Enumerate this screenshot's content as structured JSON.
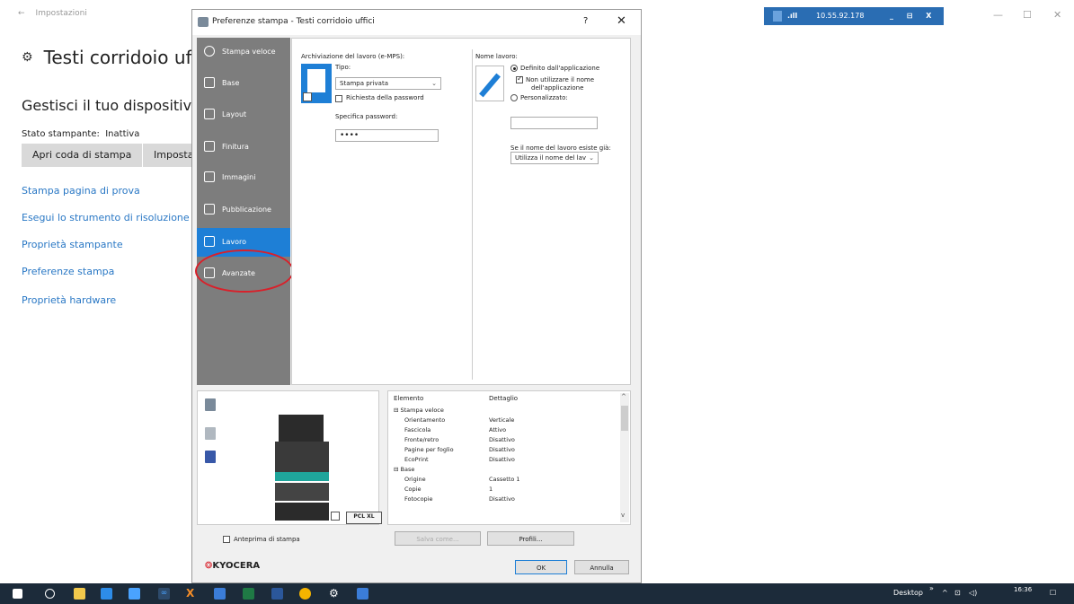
{
  "background_window": {
    "back_label": "Impostazioni",
    "title": "Testi corridoio uff",
    "manage_heading": "Gestisci il tuo dispositivo",
    "status_label": "Stato stampante:",
    "status_value": "Inattiva",
    "buttons": [
      "Apri coda di stampa",
      "Imposta c"
    ],
    "links": [
      "Stampa pagina di prova",
      "Esegui lo strumento di risoluzione dei",
      "Proprietà stampante",
      "Preferenze stampa",
      "Proprietà hardware"
    ]
  },
  "remote_bar": {
    "ip": "10.55.92.178",
    "controls": "_ ⊟ X"
  },
  "dialog": {
    "title": "Preferenze stampa - Testi corridoio uffici",
    "help": "?",
    "close": "✕",
    "sidebar": [
      {
        "label": "Stampa veloce",
        "active": false
      },
      {
        "label": "Base",
        "active": false
      },
      {
        "label": "Layout",
        "active": false
      },
      {
        "label": "Finitura",
        "active": false
      },
      {
        "label": "Immagini",
        "active": false
      },
      {
        "label": "Pubblicazione",
        "active": false
      },
      {
        "label": "Lavoro",
        "active": true
      },
      {
        "label": "Avanzate",
        "active": false
      }
    ],
    "job_storage": {
      "heading": "Archiviazione del lavoro (e-MPS):",
      "type_label": "Tipo:",
      "type_value": "Stampa privata",
      "require_password_label": "Richiesta della password",
      "require_password_checked": false,
      "specify_password_label": "Specifica password:",
      "password_value": "••••"
    },
    "job_name": {
      "heading": "Nome lavoro:",
      "option_app": "Definito dall'applicazione",
      "option_app_selected": true,
      "dont_use_app_name_line1": "Non utilizzare il nome",
      "dont_use_app_name_line2": "dell'applicazione",
      "dont_use_app_name_checked": true,
      "option_custom": "Personalizzato:",
      "custom_value": "",
      "if_exists_label": "Se il nome del lavoro esiste già:",
      "if_exists_value": "Utilizza il nome del lav"
    },
    "preview": {
      "pcl_label": "PCL XL",
      "print_preview_label": "Anteprima di stampa",
      "print_preview_checked": false
    },
    "settings_grid": {
      "headers": [
        "Elemento",
        "Dettaglio"
      ],
      "rows": [
        {
          "item": "⊟ Stampa veloce",
          "detail": "",
          "group": true
        },
        {
          "item": "Orientamento",
          "detail": "Verticale"
        },
        {
          "item": "Fascicola",
          "detail": "Attivo"
        },
        {
          "item": "Fronte/retro",
          "detail": "Disattivo"
        },
        {
          "item": "Pagine per foglio",
          "detail": "Disattivo"
        },
        {
          "item": "EcoPrint",
          "detail": "Disattivo"
        },
        {
          "item": "⊟ Base",
          "detail": "",
          "group": true
        },
        {
          "item": "Origine",
          "detail": "Cassetto 1"
        },
        {
          "item": "Copie",
          "detail": "1"
        },
        {
          "item": "Fotocopie",
          "detail": "Disattivo"
        }
      ]
    },
    "buttons": {
      "save_as": "Salva come...",
      "profiles": "Profili...",
      "ok": "OK",
      "cancel": "Annulla"
    },
    "brand": "KYOCERA"
  },
  "taskbar": {
    "desktop_label": "Desktop",
    "time": "16:36",
    "overflow": "»"
  },
  "colors": {
    "accent": "#1e7fd6",
    "highlight_circle": "#d9202a",
    "sidebar": "#7d7d7d",
    "taskbar": "#1c2b3a",
    "link": "#2a78c5"
  }
}
